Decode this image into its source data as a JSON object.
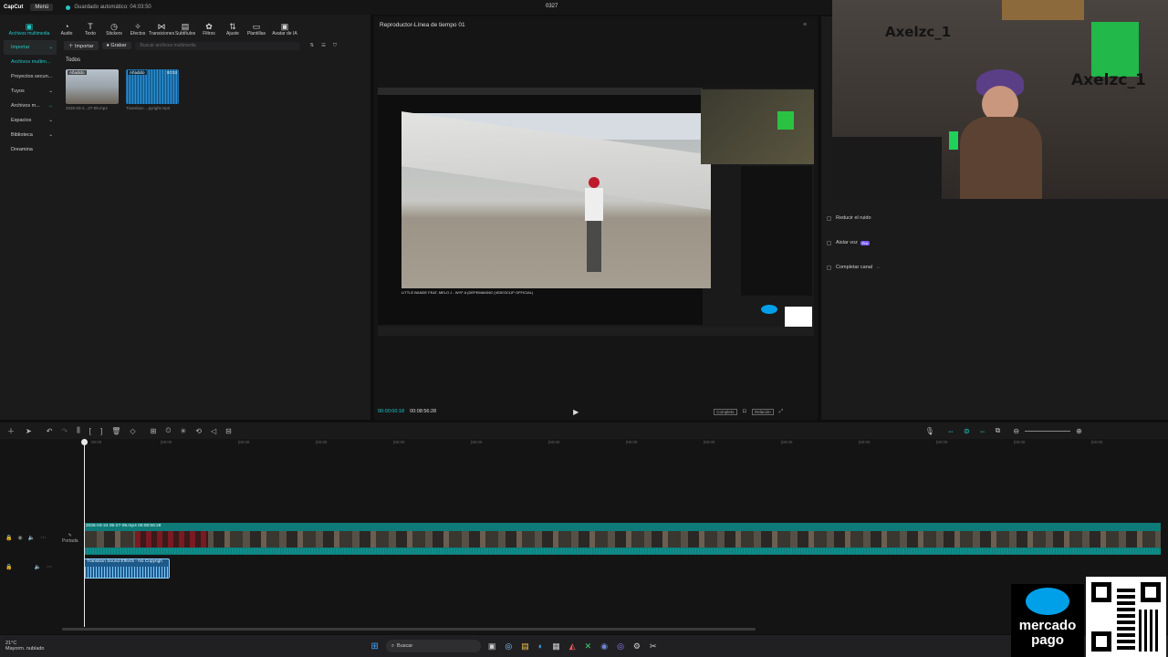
{
  "titlebar": {
    "app_logo": "CapCut",
    "menu_label": "Menú",
    "autosave": "Guardado automático: 04:03:50",
    "project_title": "0327"
  },
  "toolbar": {
    "tools": [
      {
        "label": "Archivos multimedia",
        "icon": "media-icon"
      },
      {
        "label": "Audio",
        "icon": "audio-icon"
      },
      {
        "label": "Texto",
        "icon": "text-icon"
      },
      {
        "label": "Stickers",
        "icon": "sticker-icon"
      },
      {
        "label": "Efectos",
        "icon": "effects-icon"
      },
      {
        "label": "Transiciones",
        "icon": "transitions-icon"
      },
      {
        "label": "Subtítulos",
        "icon": "subtitles-icon"
      },
      {
        "label": "Filtros",
        "icon": "filters-icon"
      },
      {
        "label": "Ajuste",
        "icon": "adjust-icon"
      },
      {
        "label": "Plantillas",
        "icon": "templates-icon"
      },
      {
        "label": "Avatar de IA",
        "icon": "avatar-icon"
      }
    ]
  },
  "leftnav": {
    "items": [
      {
        "label": "Importar"
      },
      {
        "label": "Archivos multim..."
      },
      {
        "label": "Proyectos secun..."
      },
      {
        "label": "Tuyos"
      },
      {
        "label": "Archivos m..."
      },
      {
        "label": "Espacios"
      },
      {
        "label": "Biblioteca"
      },
      {
        "label": "Dreamina"
      }
    ]
  },
  "media": {
    "import_label": "Importar",
    "record_label": "Grabar",
    "search_placeholder": "Buscar archivos multimedia",
    "section_title": "Todos",
    "items": [
      {
        "tag": "Añadido",
        "duration": "",
        "caption": "2026-03-2...27-09.mp4"
      },
      {
        "tag": "Añadido",
        "duration": "00:03",
        "caption": "Transition ...pyright.mp3"
      }
    ]
  },
  "player": {
    "title": "Reproductor-Línea de tiempo 01",
    "current_time": "00:00:00:18",
    "total_time": "00:08:56:28",
    "ratio_label": "Completo",
    "ratio2_label": "Relación"
  },
  "rightpanel": {
    "options": [
      {
        "label": "Reducir el ruido",
        "pro": false
      },
      {
        "label": "Aislar voz",
        "pro": true
      },
      {
        "label": "Completar canal",
        "pro": false
      }
    ],
    "pro_label": "Pro"
  },
  "timeline": {
    "ruler": [
      "00:00",
      "|00:00",
      "|00:00",
      "|00:00",
      "|00:00",
      "|00:00",
      "|00:00",
      "|00:00",
      "|00:00",
      "|00:00",
      "|00:00",
      "|00:00",
      "|00:00",
      "|00:00"
    ],
    "video_clip_label": "2026-03-24 05-27-09.mp4   00:08:56:28",
    "audio_clip_label": "Transition Sound Effects - No Copyrigh",
    "cover_label": "Portada"
  },
  "taskbar": {
    "weather_temp": "21°C",
    "weather_desc": "Mayorm. nublado",
    "search_label": "Buscar"
  },
  "overlay": {
    "brand_line1": "mercado",
    "brand_line2": "pago",
    "streamer_name": "Axelzc_1",
    "video_title": "LITTLE BANDE FEAT. MELO J - WYF A (DEPEMAKING (VIDEOCLIP OFFICIAL)"
  },
  "colors": {
    "accent": "#22c6c8",
    "audio_clip": "#1d5a8a",
    "video_track": "#0e7b78",
    "mp_blue": "#00a0e9"
  }
}
